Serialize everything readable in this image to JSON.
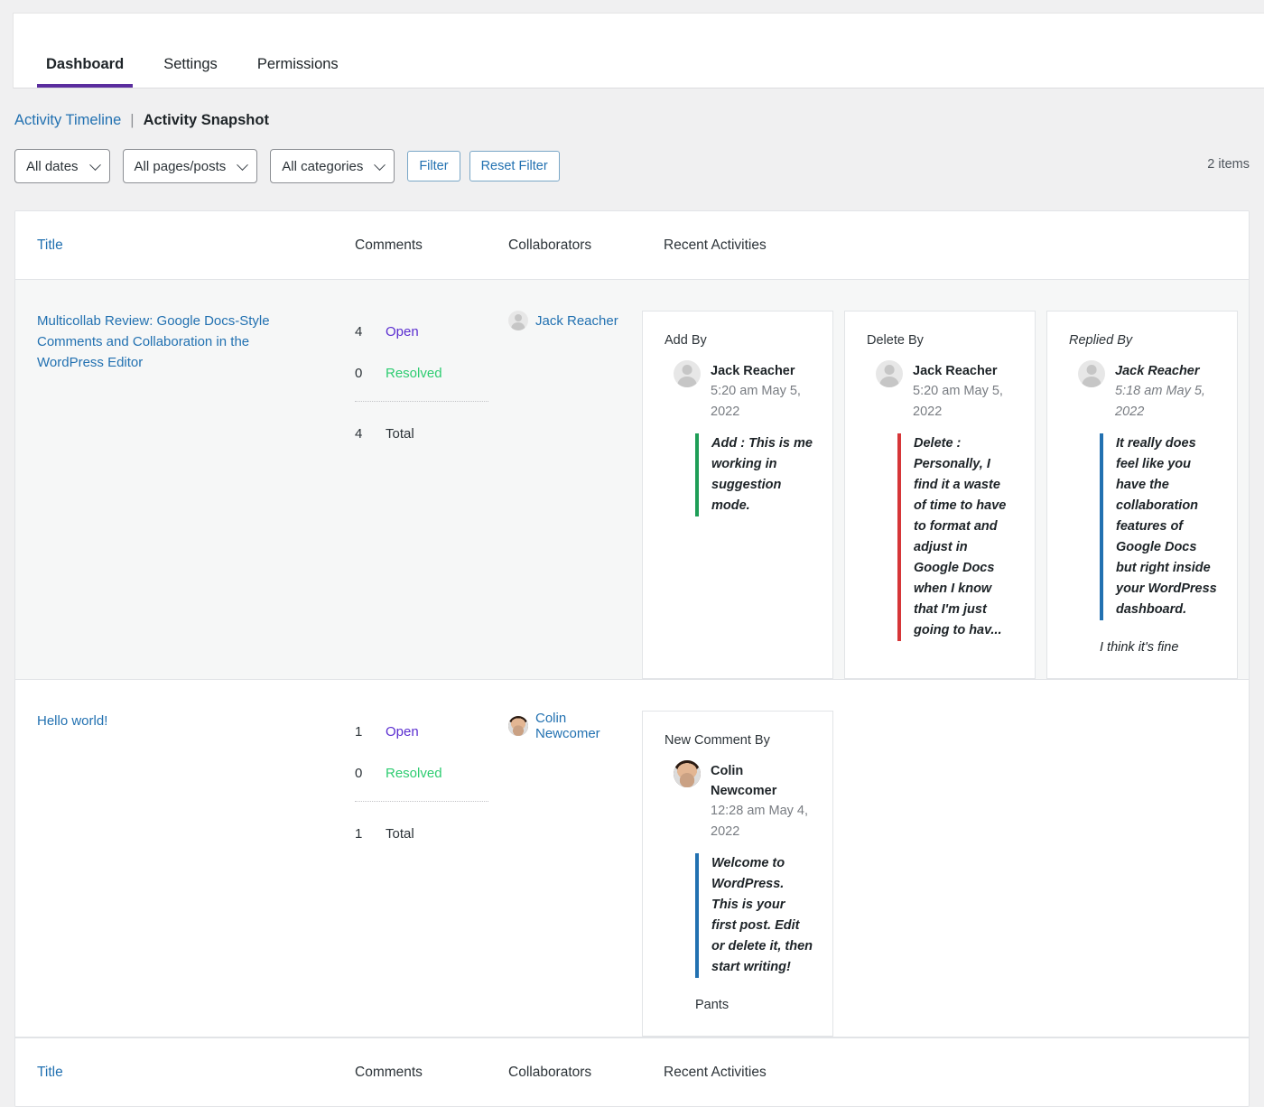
{
  "tabs": [
    {
      "label": "Dashboard",
      "active": true
    },
    {
      "label": "Settings",
      "active": false
    },
    {
      "label": "Permissions",
      "active": false
    }
  ],
  "breadcrumb": {
    "link": "Activity Timeline",
    "separator": "|",
    "current": "Activity Snapshot"
  },
  "toolbar": {
    "date_filter": "All dates",
    "page_filter": "All pages/posts",
    "category_filter": "All categories",
    "filter_button": "Filter",
    "reset_button": "Reset Filter",
    "items_count": "2 items"
  },
  "table": {
    "columns": [
      "Title",
      "Comments",
      "Collaborators",
      "Recent Activities"
    ],
    "rows": [
      {
        "title": "Multicollab Review: Google Docs-Style Comments and Collaboration in the WordPress Editor",
        "comments": {
          "open_count": "4",
          "open_label": "Open",
          "resolved_count": "0",
          "resolved_label": "Resolved",
          "total_count": "4",
          "total_label": "Total"
        },
        "collaborators": [
          {
            "name": "Jack Reacher",
            "avatar": "anon"
          }
        ],
        "activities": [
          {
            "kind": "Add By",
            "author": "Jack Reacher",
            "time": "5:20 am May 5, 2022",
            "avatar": "anon",
            "quote": "Add : This is me working in suggestion mode.",
            "accent": "green",
            "italic_kind": false,
            "note": ""
          },
          {
            "kind": "Delete By",
            "author": "Jack Reacher",
            "time": "5:20 am May 5, 2022",
            "avatar": "anon",
            "quote": "Delete : Personally, I find it a waste of time to have to format and adjust in Google Docs when I know that I'm just going to hav...",
            "accent": "red",
            "italic_kind": false,
            "note": ""
          },
          {
            "kind": "Replied By",
            "author": "Jack Reacher",
            "time": "5:18 am May 5, 2022",
            "avatar": "anon",
            "quote": "It really does feel like you have the collaboration features of Google Docs but right inside your WordPress dashboard.",
            "accent": "blue",
            "italic_kind": true,
            "note": "I think it's fine"
          }
        ]
      },
      {
        "title": "Hello world!",
        "comments": {
          "open_count": "1",
          "open_label": "Open",
          "resolved_count": "0",
          "resolved_label": "Resolved",
          "total_count": "1",
          "total_label": "Total"
        },
        "collaborators": [
          {
            "name": "Colin Newcomer",
            "avatar": "photo"
          }
        ],
        "activities": [
          {
            "kind": "New Comment By",
            "author": "Colin Newcomer",
            "time": "12:28 am May 4, 2022",
            "avatar": "photo",
            "quote": "Welcome to WordPress. This is your first post. Edit or delete it, then start writing!",
            "accent": "blue",
            "italic_kind": false,
            "note": "Pants"
          }
        ]
      }
    ],
    "footer_columns": [
      "Title",
      "Comments",
      "Collaborators",
      "Recent Activities"
    ]
  },
  "colors": {
    "accent_purple": "#5a2d9e",
    "link_blue": "#2271b1",
    "open_purple": "#5a2dd0",
    "resolved_green": "#2ecc71",
    "delete_red": "#d63638",
    "add_green": "#1e9e57"
  }
}
